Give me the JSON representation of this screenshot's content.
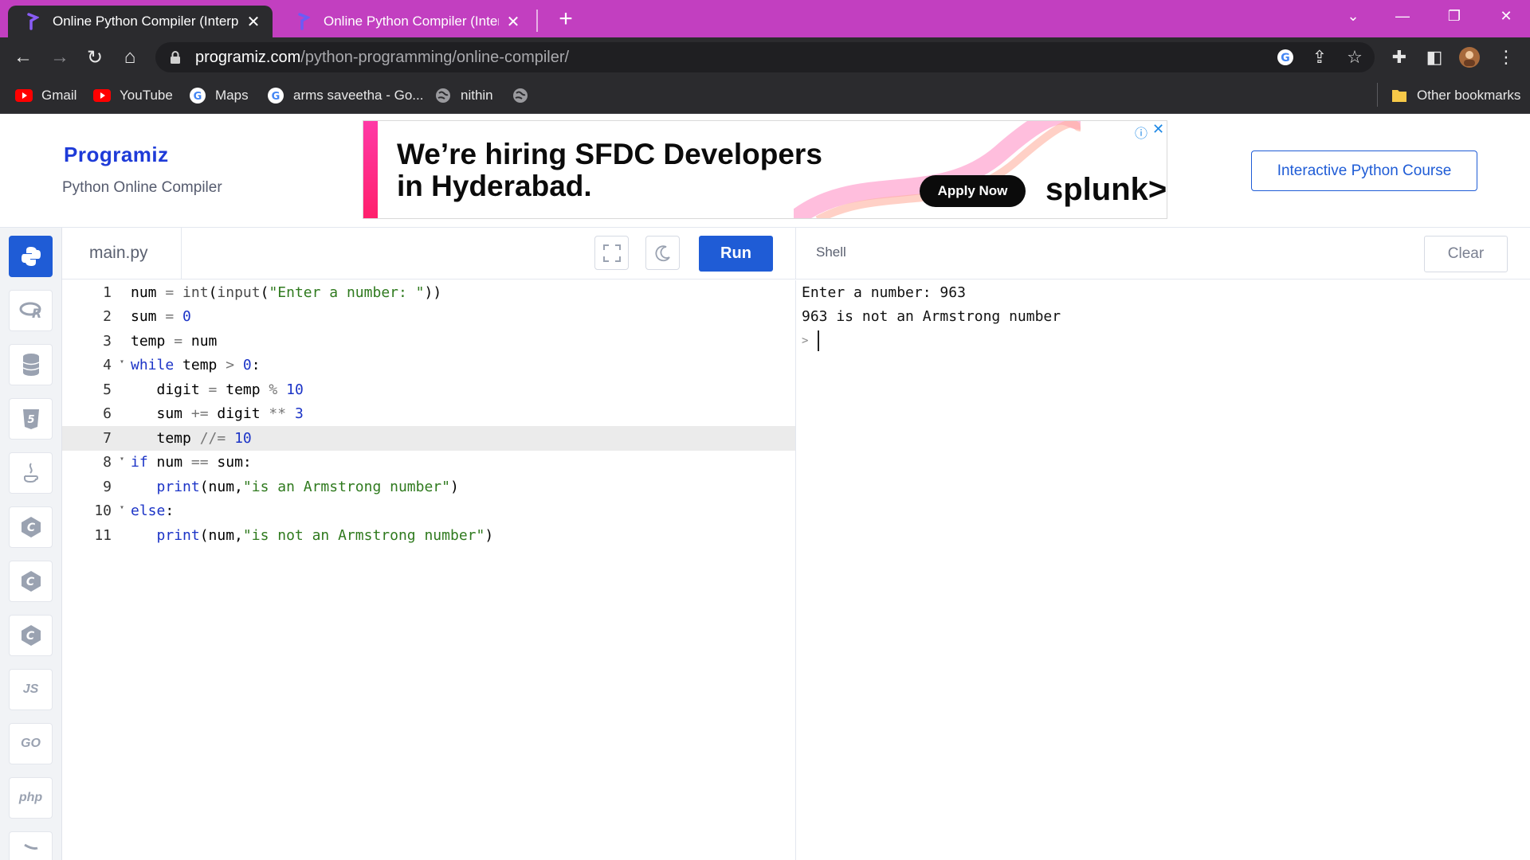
{
  "browser": {
    "tabs": [
      {
        "title": "Online Python Compiler (Interpre",
        "active": true
      },
      {
        "title": "Online Python Compiler (Interpre",
        "active": false
      }
    ],
    "url_host": "programiz.com",
    "url_path": "/python-programming/online-compiler/",
    "bookmarks": [
      "Gmail",
      "YouTube",
      "Maps",
      "arms saveetha - Go...",
      "nithin",
      "Other bookmarks"
    ]
  },
  "site": {
    "logo": "Programiz",
    "subtitle": "Python Online Compiler",
    "ad_headline_1": "We’re hiring SFDC Developers",
    "ad_headline_2": "in Hyderabad.",
    "ad_cta": "Apply Now",
    "ad_brand": "splunk>",
    "course_button": "Interactive Python Course"
  },
  "sidebar_langs": [
    "python",
    "r",
    "sql",
    "html",
    "java",
    "c",
    "cpp",
    "csharp",
    "JS",
    "GO",
    "php",
    "swift"
  ],
  "editor": {
    "filename": "main.py",
    "run_label": "Run",
    "highlight_line": 7,
    "line_numbers": [
      "1",
      "2",
      "3",
      "4",
      "5",
      "6",
      "7",
      "8",
      "9",
      "10",
      "11"
    ]
  },
  "shell": {
    "title": "Shell",
    "clear_label": "Clear",
    "lines": [
      "Enter a number: 963",
      "963 is not an Armstrong number"
    ],
    "prompt": ">"
  },
  "colors": {
    "tab_strip": "#c23fc0",
    "chrome_dark": "#2b2b2e",
    "accent_blue": "#1f5cd6"
  }
}
